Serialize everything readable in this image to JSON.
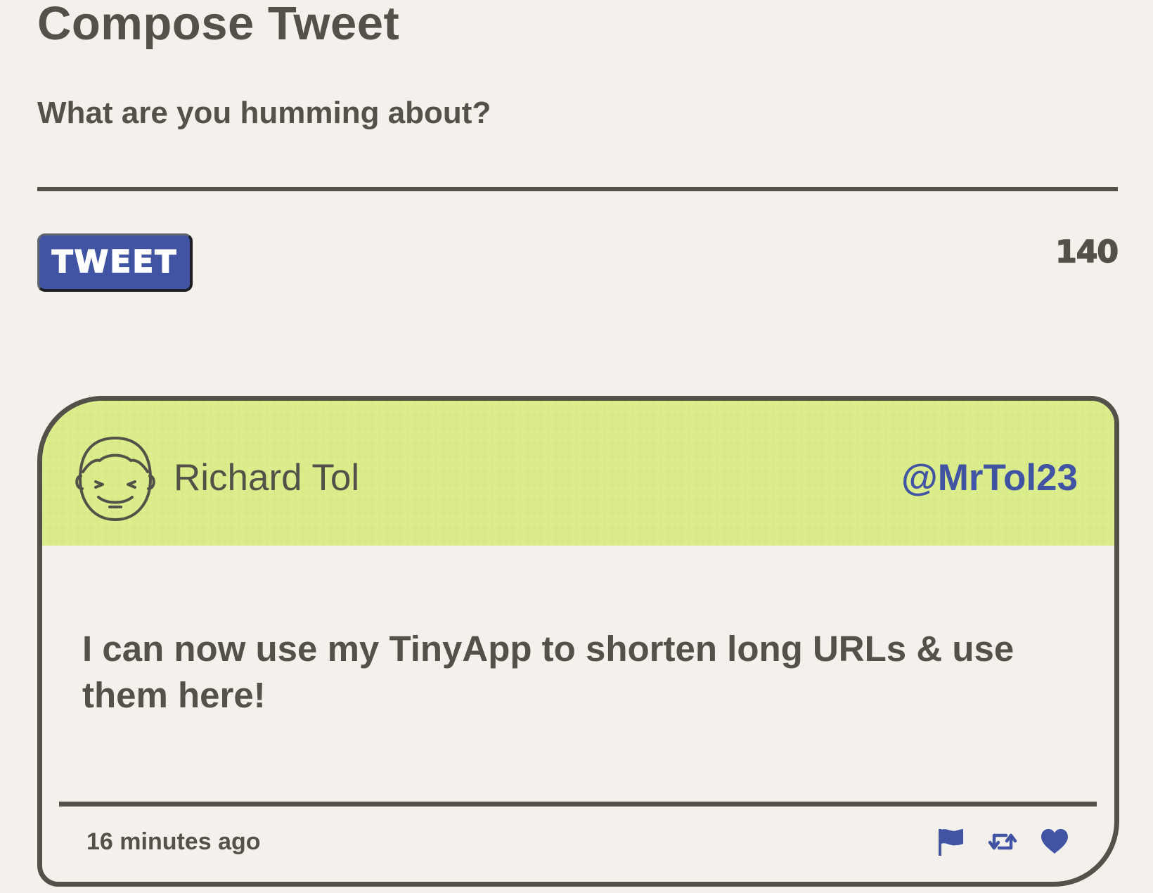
{
  "compose": {
    "title": "Compose Tweet",
    "label": "What are you humming about?",
    "input_value": "",
    "button_label": "TWEET",
    "char_count": "140"
  },
  "tweet": {
    "author_name": "Richard Tol",
    "author_handle": "@MrTol23",
    "content": "I can now use my TinyApp to shorten long URLs & use them here!",
    "timestamp": "16 minutes ago",
    "avatar_icon": "smiling-face-avatar-icon",
    "actions": [
      "flag-icon",
      "retweet-icon",
      "heart-icon"
    ]
  },
  "colors": {
    "background": "#f4f1ec",
    "text": "#545149",
    "accent": "#4154a3",
    "header": "#dbec8a"
  }
}
